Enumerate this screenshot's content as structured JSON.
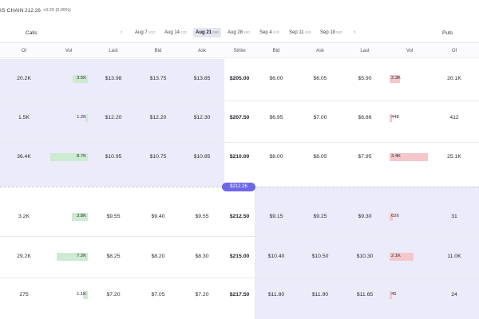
{
  "header": {
    "title": "IS CHAIN",
    "price": "212.26",
    "change": "+0.20 (0.09%)"
  },
  "nav": {
    "calls_label": "Calls",
    "puts_label": "Puts",
    "prev_arrow": "‹",
    "next_arrow": "›",
    "expirations": [
      {
        "date": "Aug 7",
        "days": "1DD"
      },
      {
        "date": "Aug 14",
        "days": "22D"
      },
      {
        "date": "Aug 21",
        "days": "29D"
      },
      {
        "date": "Aug 28",
        "days": "36D"
      },
      {
        "date": "Sep 4",
        "days": "41D"
      },
      {
        "date": "Sep 11",
        "days": "48D"
      },
      {
        "date": "Sep 18",
        "days": "55D"
      }
    ],
    "active_expiration": "Aug 21"
  },
  "columns": {
    "calls": [
      "OI",
      "Vol",
      "Last",
      "Bid",
      "Ask"
    ],
    "strike": "Strike",
    "puts": [
      "Bid",
      "Ask",
      "Last",
      "Vol",
      "OI"
    ]
  },
  "current_price_label": "$212.26",
  "rows": [
    {
      "call_oi": "20.2K",
      "call_vol": "3.5K",
      "call_vol_frac": 0.4,
      "call_last": "$13.98",
      "call_bid": "$13.75",
      "call_ask": "$13.85",
      "strike": "$205.00",
      "put_bid": "$6.00",
      "put_ask": "$6.05",
      "put_last": "$5.90",
      "put_vol": "2.3K",
      "put_vol_frac": 0.26,
      "put_oi": "20.1K"
    },
    {
      "call_oi": "1.5K",
      "call_vol": "1.2K",
      "call_vol_frac": 0.06,
      "call_last": "$12.20",
      "call_bid": "$12.20",
      "call_ask": "$12.30",
      "strike": "$207.50",
      "put_bid": "$6.95",
      "put_ask": "$7.00",
      "put_last": "$6.86",
      "put_vol": "448",
      "put_vol_frac": 0.06,
      "put_oi": "412"
    },
    {
      "call_oi": "36.4K",
      "call_vol": "8.7K",
      "call_vol_frac": 0.98,
      "call_last": "$10.95",
      "call_bid": "$10.75",
      "call_ask": "$10.85",
      "strike": "$210.00",
      "put_bid": "$8.00",
      "put_ask": "$8.05",
      "put_last": "$7.95",
      "put_vol": "3.4K",
      "put_vol_frac": 0.98,
      "put_oi": "25.1K"
    },
    {
      "call_oi": "3.2K",
      "call_vol": "3.8K",
      "call_vol_frac": 0.42,
      "call_last": "$9.55",
      "call_bid": "$9.40",
      "call_ask": "$9.55",
      "strike": "$212.50",
      "put_bid": "$9.15",
      "put_ask": "$9.25",
      "put_last": "$9.30",
      "put_vol": "626",
      "put_vol_frac": 0.08,
      "put_oi": "31"
    },
    {
      "call_oi": "29.2K",
      "call_vol": "7.2K",
      "call_vol_frac": 0.82,
      "call_last": "$8.25",
      "call_bid": "$8.20",
      "call_ask": "$8.30",
      "strike": "$215.00",
      "put_bid": "$10.40",
      "put_ask": "$10.50",
      "put_last": "$10.30",
      "put_vol": "2.1K",
      "put_vol_frac": 0.62,
      "put_oi": "11.0K"
    },
    {
      "call_oi": "275",
      "call_vol": "1.1K",
      "call_vol_frac": 0.12,
      "call_last": "$7.20",
      "call_bid": "$7.05",
      "call_ask": "$7.20",
      "strike": "$217.50",
      "put_bid": "$11.80",
      "put_ask": "$11.90",
      "put_last": "$11.65",
      "put_vol": "45",
      "put_vol_frac": 0.06,
      "put_oi": "24"
    }
  ],
  "colors": {
    "itm_background": "#ebebfa",
    "call_volume_bar": "#cdebd2",
    "put_volume_bar": "#f4c7cb",
    "price_pill": "#6d68e8"
  }
}
